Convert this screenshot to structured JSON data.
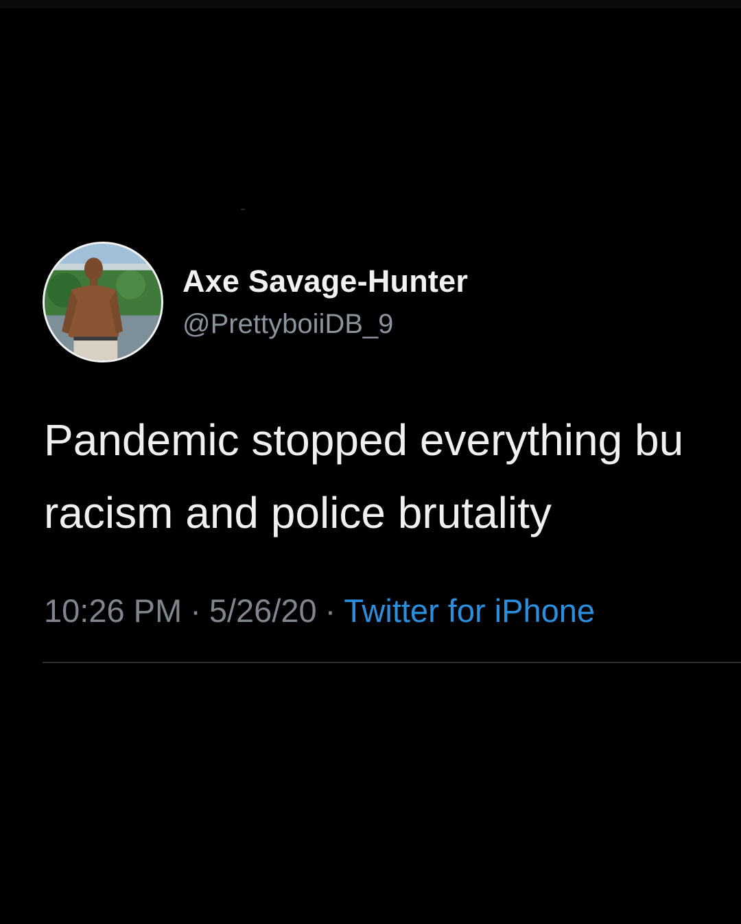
{
  "tweet": {
    "author": {
      "display_name": "Axe Savage-Hunter",
      "handle": "@PrettyboiiDB_9",
      "avatar_icon": "profile-photo"
    },
    "text_lines": [
      "Pandemic stopped everything bu",
      "racism and police brutality"
    ],
    "meta": {
      "time": "10:26 PM",
      "separator": "·",
      "date": "5/26/20",
      "source": "Twitter for iPhone"
    }
  },
  "colors": {
    "background": "#000000",
    "name_text": "#f1f1f1",
    "handle_text": "#8b949c",
    "body_text": "#f0f0f0",
    "meta_text": "#7f868d",
    "source_link": "#2b8fe0",
    "divider": "#2a2c2e"
  }
}
